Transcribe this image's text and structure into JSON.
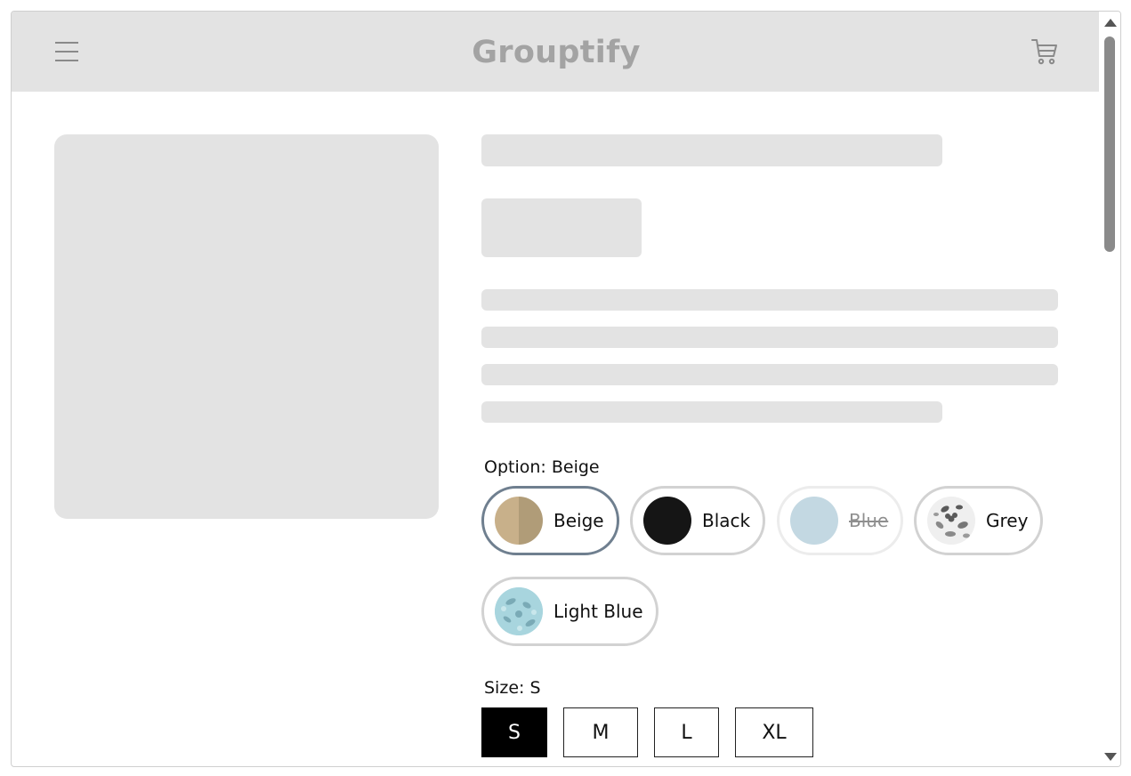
{
  "header": {
    "brand": "Grouptify",
    "menu_icon": "hamburger-menu-icon",
    "cart_icon": "shopping-cart-icon",
    "background": "#e3e3e3"
  },
  "product": {
    "option_label": "Option: Beige",
    "options": [
      {
        "label": "Beige",
        "state": "selected",
        "icon": "beige-swatch"
      },
      {
        "label": "Black",
        "state": "available",
        "icon": "black-swatch"
      },
      {
        "label": "Blue",
        "state": "unavailable",
        "icon": "blue-swatch"
      },
      {
        "label": "Grey",
        "state": "available",
        "icon": "grey-floral-swatch"
      },
      {
        "label": "Light Blue",
        "state": "available",
        "icon": "light-blue-floral-swatch"
      }
    ],
    "size_label": "Size: S",
    "sizes": [
      {
        "label": "S",
        "state": "selected"
      },
      {
        "label": "M",
        "state": "available"
      },
      {
        "label": "L",
        "state": "available"
      },
      {
        "label": "XL",
        "state": "available"
      }
    ]
  },
  "colors": {
    "selected_border": "#6f7f8f",
    "placeholder": "#e3e3e3",
    "beige_light": "#c8b08a",
    "beige_dark": "#b09c78",
    "black": "#151515",
    "blue": "#c3d8e2"
  }
}
